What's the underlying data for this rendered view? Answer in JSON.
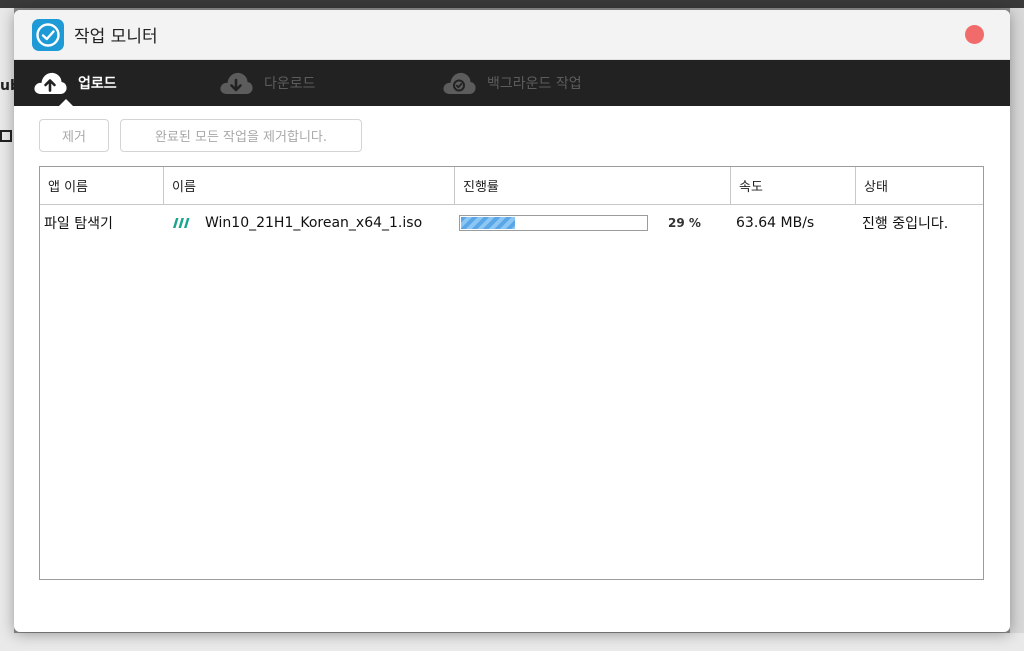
{
  "background": {
    "left_text": "ub"
  },
  "window": {
    "title": "작업 모니터",
    "accent": "#1e9ad6",
    "close_color": "#f26b6b"
  },
  "tabs": [
    {
      "label": "업로드",
      "icon": "cloud-upload-icon",
      "active": true
    },
    {
      "label": "다운로드",
      "icon": "cloud-download-icon",
      "active": false
    },
    {
      "label": "백그라운드 작업",
      "icon": "cloud-check-icon",
      "active": false
    }
  ],
  "toolbar": {
    "remove_label": "제거",
    "clear_completed_label": "완료된 모든 작업을 제거합니다."
  },
  "table": {
    "columns": [
      "앱 이름",
      "이름",
      "진행률",
      "속도",
      "상태"
    ],
    "rows": [
      {
        "app": "파일 탐색기",
        "name": "Win10_21H1_Korean_x64_1.iso",
        "progress": 29,
        "progress_text": "29 %",
        "speed": "63.64 MB/s",
        "status": "진행 중입니다.",
        "file_icon": "striped-file-icon"
      }
    ]
  }
}
